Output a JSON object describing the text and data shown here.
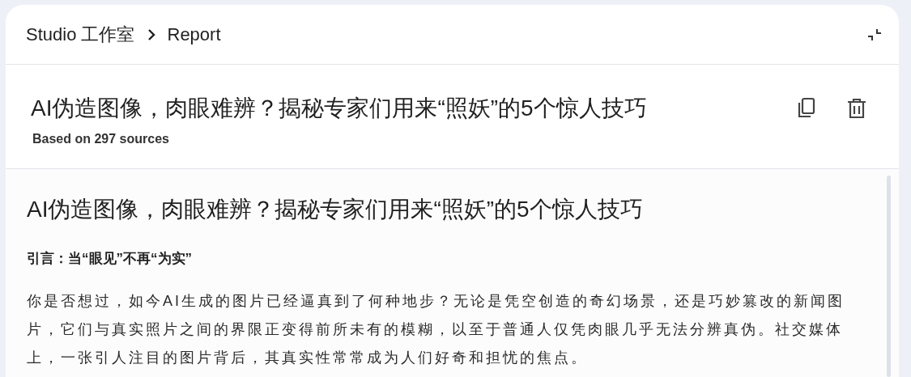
{
  "breadcrumb": [
    {
      "text": "Studio 工作室"
    },
    {
      "text": "Report"
    }
  ],
  "report": {
    "title": "AI伪造图像，肉眼难辨？揭秘专家们用来“照妖”的5个惊人技巧",
    "subtitle": "Based on 297 sources"
  },
  "document": {
    "heading": "AI伪造图像，肉眼难辨？揭秘专家们用来“照妖”的5个惊人技巧",
    "section_heading": "引言：当“眼见”不再“为实”",
    "paragraph": "你是否想过，如今AI生成的图片已经逼真到了何种地步？无论是凭空创造的奇幻场景，还是巧妙篡改的新闻图片，它们与真实照片之间的界限正变得前所未有的模糊，以至于普通人仅凭肉眼几乎无法分辨真伪。社交媒体上，一张引人注目的图片背后，其真实性常常成为人们好奇和担忧的焦点。"
  }
}
